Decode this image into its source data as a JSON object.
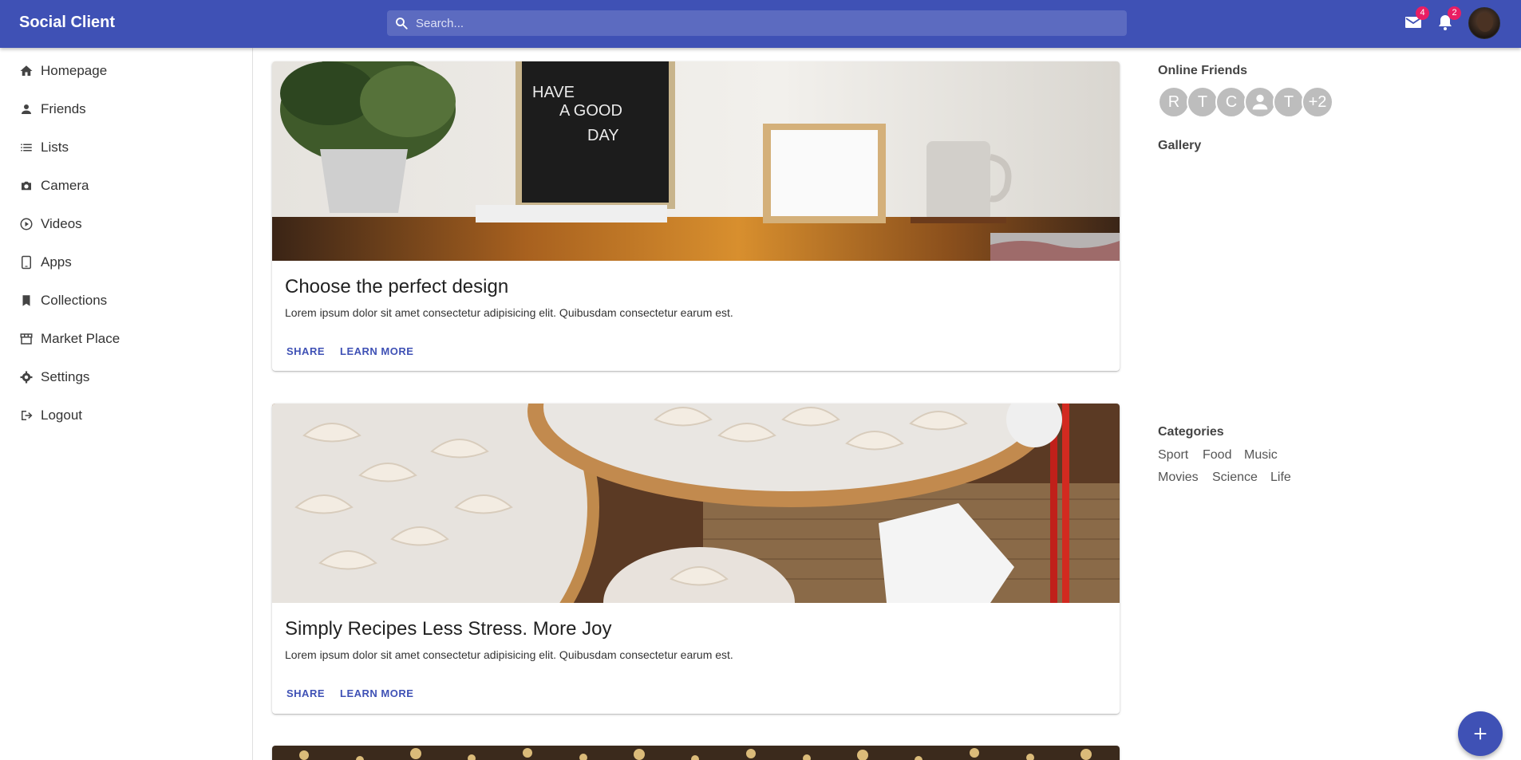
{
  "app": {
    "title": "Social Client"
  },
  "search": {
    "placeholder": "Search..."
  },
  "topbar": {
    "mail_count": "4",
    "notification_count": "2"
  },
  "sidebar": {
    "items": [
      {
        "label": "Homepage",
        "icon": "home-icon"
      },
      {
        "label": "Friends",
        "icon": "person-icon"
      },
      {
        "label": "Lists",
        "icon": "list-icon"
      },
      {
        "label": "Camera",
        "icon": "camera-icon"
      },
      {
        "label": "Videos",
        "icon": "play-circle-icon"
      },
      {
        "label": "Apps",
        "icon": "tablet-icon"
      },
      {
        "label": "Collections",
        "icon": "bookmark-icon"
      },
      {
        "label": "Market Place",
        "icon": "storefront-icon"
      },
      {
        "label": "Settings",
        "icon": "gear-icon"
      },
      {
        "label": "Logout",
        "icon": "logout-icon"
      }
    ]
  },
  "posts": [
    {
      "title": "Choose the perfect design",
      "text": "Lorem ipsum dolor sit amet consectetur adipisicing elit. Quibusdam consectetur earum est.",
      "share_label": "SHARE",
      "learn_label": "LEARN MORE",
      "board_text": [
        "HAVE",
        "A GOOD",
        "DAY"
      ]
    },
    {
      "title": "Simply Recipes Less Stress. More Joy",
      "text": "Lorem ipsum dolor sit amet consectetur adipisicing elit. Quibusdam consectetur earum est.",
      "share_label": "SHARE",
      "learn_label": "LEARN MORE"
    }
  ],
  "right_panel": {
    "online_friends_title": "Online Friends",
    "friends": [
      "R",
      "T",
      "C",
      "",
      "T",
      "+2"
    ],
    "gallery_title": "Gallery",
    "categories_title": "Categories",
    "categories": [
      "Sport",
      "Food",
      "Music",
      "Movies",
      "Science",
      "Life"
    ]
  },
  "colors": {
    "primary": "#3f51b5",
    "badge": "#e91e63",
    "search_bg": "#5c6bc0"
  }
}
